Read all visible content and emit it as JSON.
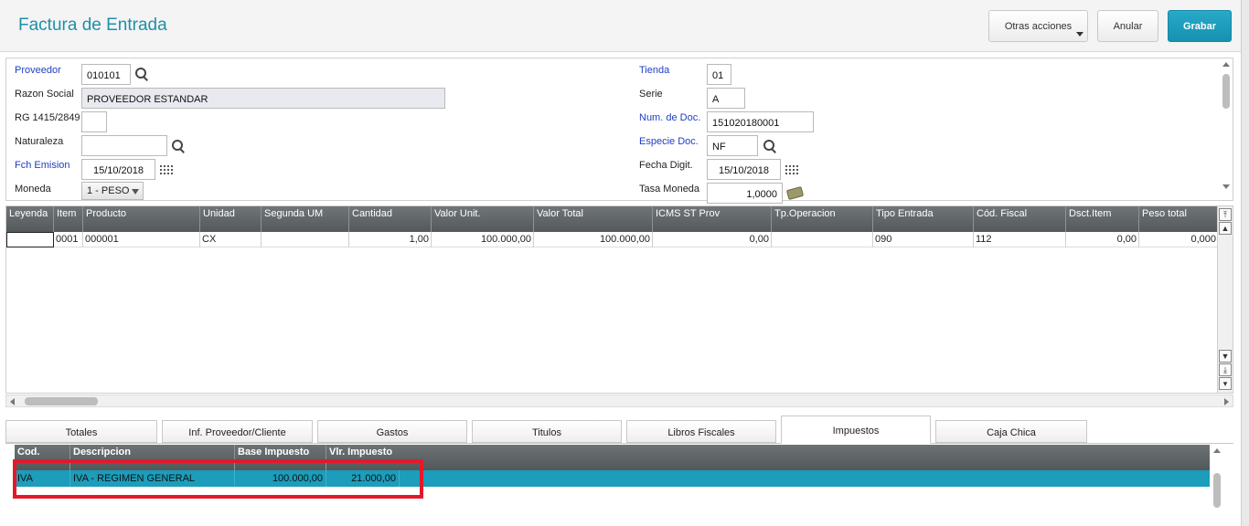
{
  "header": {
    "title": "Factura de Entrada",
    "otras_acciones": "Otras acciones",
    "anular": "Anular",
    "grabar": "Grabar"
  },
  "form": {
    "proveedor_label": "Proveedor",
    "proveedor_value": "010101",
    "razon_label": "Razon Social",
    "razon_value": "PROVEEDOR ESTANDAR",
    "rg_label": "RG 1415/2849",
    "rg_value": "",
    "naturaleza_label": "Naturaleza",
    "naturaleza_value": "",
    "fch_emision_label": "Fch Emision",
    "fch_emision_value": "15/10/2018",
    "moneda_label": "Moneda",
    "moneda_value": "1 - PESO",
    "tienda_label": "Tienda",
    "tienda_value": "01",
    "serie_label": "Serie",
    "serie_value": "A",
    "num_doc_label": "Num. de Doc.",
    "num_doc_value": "151020180001",
    "especie_label": "Especie Doc.",
    "especie_value": "NF",
    "fecha_digit_label": "Fecha Digit.",
    "fecha_digit_value": "15/10/2018",
    "tasa_label": "Tasa Moneda",
    "tasa_value": "1,0000"
  },
  "grid": {
    "columns": [
      "Leyenda",
      "Item",
      "Producto",
      "Unidad",
      "Segunda UM",
      "Cantidad",
      "Valor Unit.",
      "Valor Total",
      "ICMS ST Prov",
      "Tp.Operacion",
      "Tipo Entrada",
      "Cód. Fiscal",
      "Dsct.Item",
      "Peso total"
    ],
    "rows": [
      [
        "",
        "0001",
        "000001",
        "CX",
        "",
        "1,00",
        "100.000,00",
        "100.000,00",
        "0,00",
        "",
        "090",
        "112",
        "0,00",
        "0,000"
      ]
    ]
  },
  "tabs": [
    "Totales",
    "Inf. Proveedor/Cliente",
    "Gastos",
    "Titulos",
    "Libros Fiscales",
    "Impuestos",
    "Caja Chica"
  ],
  "tax": {
    "columns": [
      "Cod.",
      "Descripcion",
      "Base Impuesto",
      "Vlr. Impuesto"
    ],
    "rows": [
      [
        "IVA",
        "IVA - REGIMEN GENERAL",
        "100.000,00",
        "21.000,00"
      ]
    ]
  },
  "colors": {
    "accent": "#1e8fab",
    "selected_row": "#1b9dbb",
    "highlight_box": "#e3192a"
  }
}
